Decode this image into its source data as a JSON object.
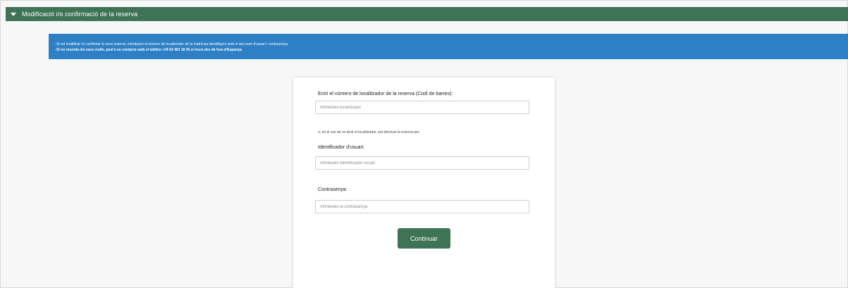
{
  "header": {
    "title": "Modificació i/o confirmació de la reserva",
    "toggle_icon": "caret-down-icon"
  },
  "banner": {
    "line1": "- Si vol modificar i/o confirmar la seva reserva, introdueixi el número de localitzador de la matrícula identifiqui's amb el seu nom d'usuari i contrasenya.",
    "line2": "- Si no recorda els seus codis, posi's en contacte amb el telèfon +34 93 403 18 30 si truca des de fora d'Espanya."
  },
  "form": {
    "locator_label": "Entri el número de localitzador de la reserva (Codi de barres):",
    "locator_placeholder": "Introdueix localitzador",
    "alt_text": "o, en el cas de no tenir el localitzador, pot efectuar la reserva per:",
    "user_label": "Identificador d'usuari:",
    "user_placeholder": "Introdueix identificador usuari",
    "password_label": "Contrasenya:",
    "password_placeholder": "Introdueix la contrasenya",
    "submit_label": "Continuar"
  },
  "colors": {
    "header_green": "#3f7356",
    "banner_blue": "#2d7fc6",
    "button_green": "#3f7356"
  }
}
